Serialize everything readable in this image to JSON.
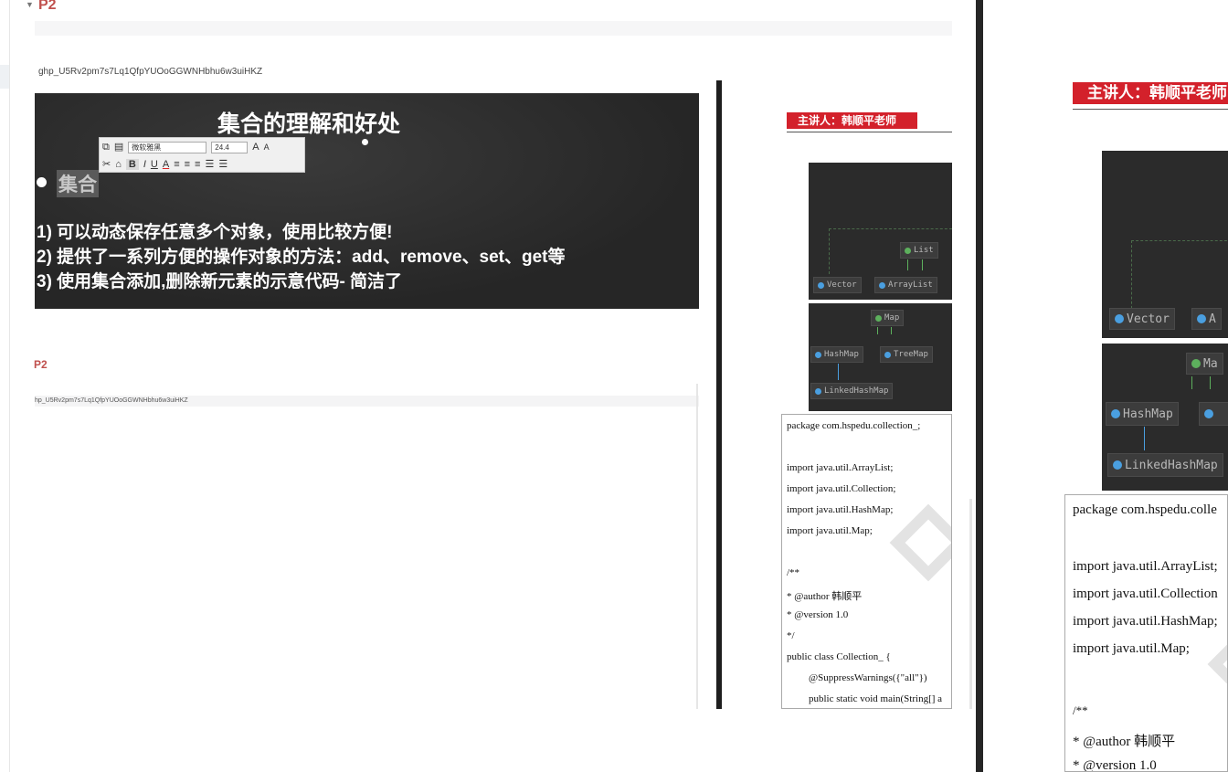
{
  "heading": {
    "toggle_glyph": "▼",
    "title": "P2"
  },
  "token_text": "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",
  "slide": {
    "title": "集合的理解和好处",
    "bullet": "集合",
    "lines": [
      "1) 可以动态保存任意多个对象，使用比较方便!",
      "2) 提供了一系列方便的操作对象的方法：add、remove、set、get等",
      "3) 使用集合添加,删除新元素的示意代码- 简洁了"
    ]
  },
  "toolbar": {
    "font_name": "微软雅黑",
    "font_size": "24.4",
    "grow_icon": "A",
    "shrink_icon": "A",
    "bold": "B",
    "italic": "I",
    "underline": "U",
    "color": "A"
  },
  "second_block": {
    "title": "P2",
    "token": "hp_U5Rv2pm7s7Lq1QfpYUOoGGWNHbhu6w3uiHKZ"
  },
  "lecturer": "主讲人：韩顺平老师",
  "lecturer_large": "主讲人：韩顺平老师",
  "diagram_list": {
    "interface": "List",
    "classes": [
      "Vector",
      "ArrayList"
    ]
  },
  "diagram_map": {
    "interface": "Map",
    "classes": [
      "HashMap",
      "TreeMap",
      "LinkedHashMap"
    ]
  },
  "diagram_large": {
    "classes": [
      "Vector",
      "A"
    ],
    "map_interface": "Ma",
    "map_classes": [
      "HashMap",
      "LinkedHashMap"
    ]
  },
  "code_small": [
    "package com.hspedu.collection_;",
    "",
    "import java.util.ArrayList;",
    "import java.util.Collection;",
    "import java.util.HashMap;",
    "import java.util.Map;",
    "",
    "/**",
    " * @author  韩顺平",
    " * @version 1.0",
    " */",
    "public class Collection_ {",
    "    @SuppressWarnings({\"all\"})",
    "    public static void main(String[] a"
  ],
  "code_large": [
    "package com.hspedu.colle",
    "",
    "import java.util.ArrayList;",
    "import java.util.Collection",
    "import java.util.HashMap;",
    "import java.util.Map;",
    "",
    "/**",
    " * @author  韩顺平",
    " * @version 1.0"
  ],
  "colors": {
    "accent_red": "#c0504d",
    "lecturer_red": "#d3212b",
    "diagram_bg": "#2b2b2b",
    "class_icon": "#4a9fe0",
    "interface_icon": "#5db05d"
  }
}
